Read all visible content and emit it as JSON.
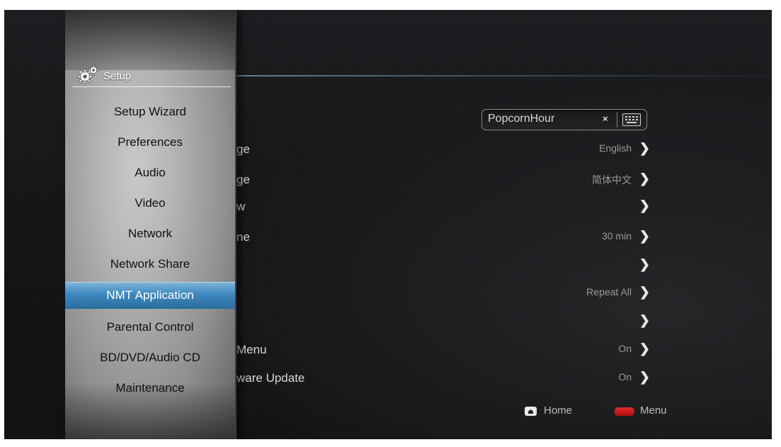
{
  "panel": {
    "title": "Setup",
    "icon": "gears-icon",
    "items": [
      {
        "label": "Setup Wizard"
      },
      {
        "label": "Preferences"
      },
      {
        "label": "Audio"
      },
      {
        "label": "Video"
      },
      {
        "label": "Network"
      },
      {
        "label": "Network Share"
      },
      {
        "label": "NMT Application"
      },
      {
        "label": "Parental Control"
      },
      {
        "label": "BD/DVD/Audio CD"
      },
      {
        "label": "Maintenance"
      }
    ],
    "selected_index": 6,
    "selected_color": "#3f89bf"
  },
  "settings": {
    "device_name": {
      "value": "PopcornHour",
      "clear_glyph": "×",
      "keyboard_icon": "keyboard-icon"
    },
    "rows": [
      {
        "label": "ge",
        "value": "English"
      },
      {
        "label": "ge",
        "value": "简体中文"
      },
      {
        "label": "w",
        "value": ""
      },
      {
        "label": "ne",
        "value": "30 min"
      },
      {
        "label": "",
        "value": ""
      },
      {
        "label": "",
        "value": "Repeat All"
      },
      {
        "label": "",
        "value": ""
      },
      {
        "label": "Menu",
        "value": "On"
      },
      {
        "label": "ware Update",
        "value": "On"
      }
    ],
    "chevron": "❯"
  },
  "legend": {
    "home_label": "Home",
    "menu_label": "Menu",
    "menu_color": "#cc1a1a"
  }
}
